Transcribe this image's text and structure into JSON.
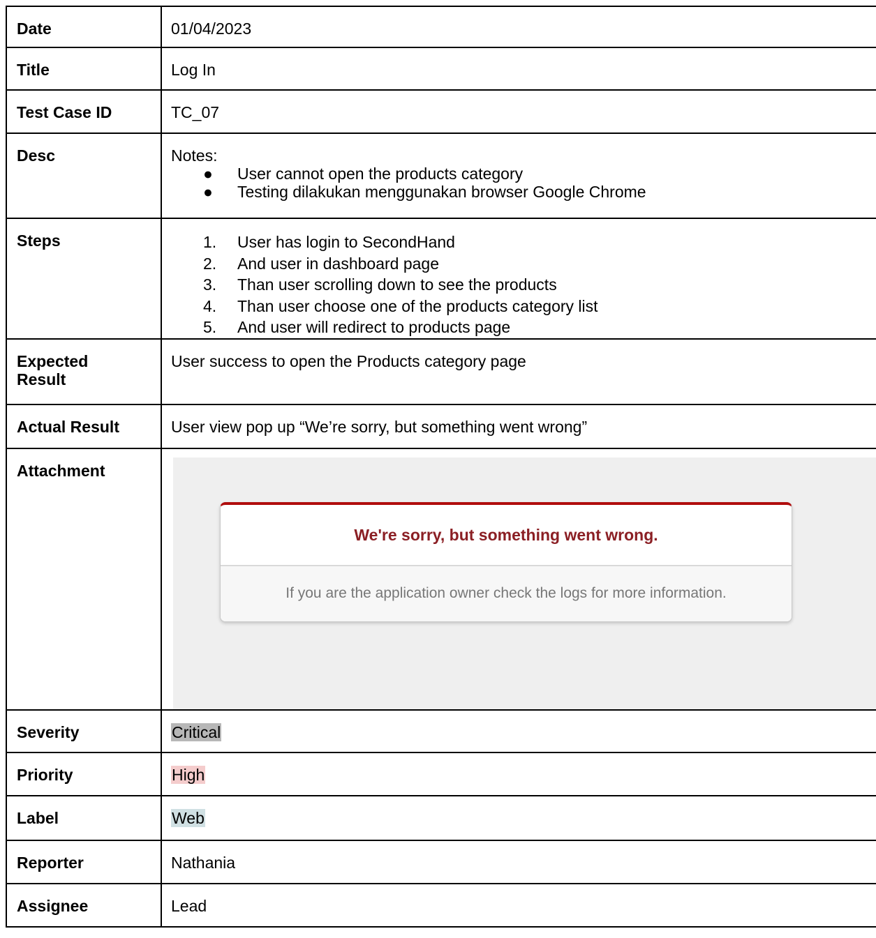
{
  "rows": {
    "date": {
      "label": "Date",
      "value": "01/04/2023"
    },
    "title": {
      "label": "Title",
      "value": "Log In"
    },
    "test_case_id": {
      "label": "Test Case ID",
      "value": "TC_07"
    },
    "desc": {
      "label": "Desc",
      "intro": "Notes:",
      "bullets": [
        "User cannot open the products category",
        "Testing dilakukan menggunakan browser Google Chrome"
      ]
    },
    "steps": {
      "label": "Steps",
      "items": [
        "User has login to SecondHand",
        "And user in dashboard page",
        "Than user scrolling down to see the products",
        "Than user choose one of the products category list",
        "And user will redirect to products page"
      ]
    },
    "expected": {
      "label_line1": "Expected",
      "label_line2": "Result",
      "value": "User success to open the Products category page"
    },
    "actual": {
      "label": "Actual Result",
      "value": "User view pop up “We’re sorry, but something went wrong”"
    },
    "attachment": {
      "label": "Attachment",
      "dialog_title": "We're sorry, but something went wrong.",
      "dialog_body": "If you are the application owner check the logs for more information."
    },
    "severity": {
      "label": "Severity",
      "value": "Critical",
      "highlight": "#b7b7b7"
    },
    "priority": {
      "label": "Priority",
      "value": "High",
      "highlight": "#f4cccc"
    },
    "label": {
      "label": "Label",
      "value": "Web",
      "highlight": "#d0e0e3"
    },
    "reporter": {
      "label": "Reporter",
      "value": "Nathania"
    },
    "assignee": {
      "label": "Assignee",
      "value": "Lead"
    }
  },
  "bullet_glyph": "●",
  "step_numbers": [
    "1.",
    "2.",
    "3.",
    "4.",
    "5."
  ]
}
